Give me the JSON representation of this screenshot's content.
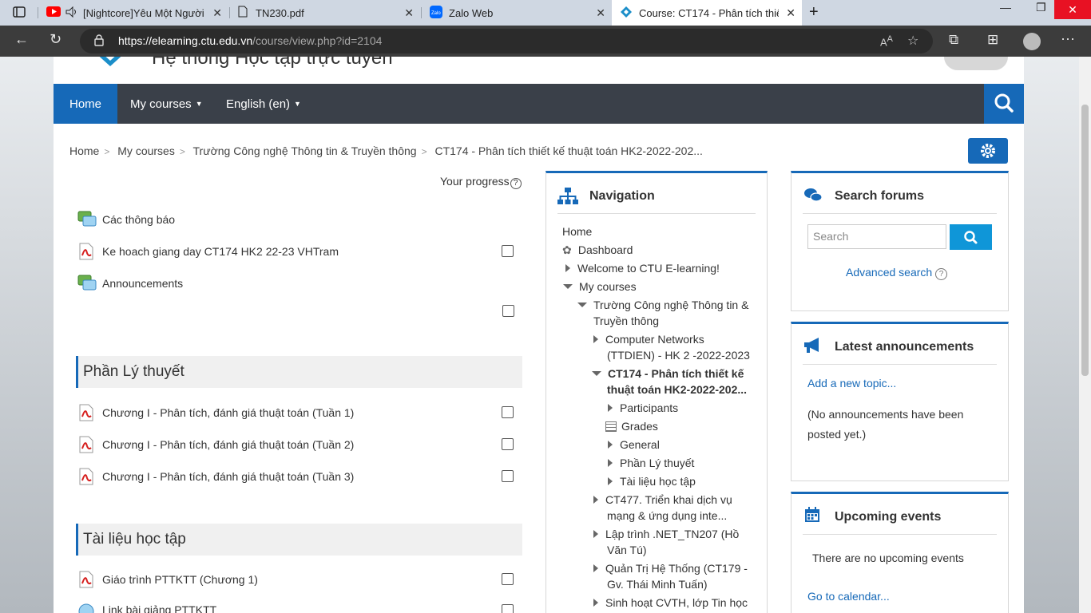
{
  "browser": {
    "tabs": [
      {
        "title": "[Nightcore]Yêu Một Người"
      },
      {
        "title": "TN230.pdf"
      },
      {
        "title": "Zalo Web"
      },
      {
        "title": "Course: CT174 - Phân tích thiết k"
      }
    ],
    "url_domain": "https://elearning.ctu.edu.vn",
    "url_path": "/course/view.php?id=2104"
  },
  "site": {
    "title": "Hệ thống Học tập trực tuyến"
  },
  "navbar": {
    "home": "Home",
    "my_courses": "My courses",
    "language": "English (en)"
  },
  "breadcrumb": [
    "Home",
    "My courses",
    "Trường Công nghệ Thông tin & Truyền thông",
    "CT174 - Phân tích thiết kế thuật toán HK2-2022-202..."
  ],
  "course": {
    "progress_label": "Your progress",
    "top_activities": [
      "Các thông báo",
      "Ke hoach giang day CT174 HK2 22-23 VHTram",
      "Announcements"
    ],
    "sections": [
      {
        "title": "Phần Lý thuyết",
        "activities": [
          "Chương I - Phân tích, đánh giá thuật toán (Tuần 1)",
          "Chương I - Phân tích, đánh giá thuật toán (Tuần 2)",
          "Chương I - Phân tích, đánh giá thuật toán (Tuần 3)"
        ]
      },
      {
        "title": "Tài liệu học tập",
        "activities": [
          "Giáo trình PTTKTT (Chương 1)",
          "Link bài giảng PTTKTT"
        ]
      }
    ]
  },
  "navigation": {
    "title": "Navigation",
    "home": "Home",
    "dashboard": "Dashboard",
    "welcome": "Welcome to CTU E-learning!",
    "my_courses": "My courses",
    "school_line1": "Trường Công nghệ Thông tin &",
    "school_line2": "Truyền thông",
    "cn_line1": "Computer Networks",
    "cn_line2": "(TTDIEN) - HK 2 -2022-2023",
    "ct174_line1": "CT174 - Phân tích thiết kế",
    "ct174_line2": "thuật toán HK2-2022-202...",
    "participants": "Participants",
    "grades": "Grades",
    "general": "General",
    "ly_thuyet": "Phần Lý thuyết",
    "tai_lieu": "Tài liệu học tập",
    "ct477_line1": "CT477. Triển khai dịch vụ",
    "ct477_line2": "mạng & ứng dụng inte...",
    "net_line1": "Lập trình .NET_TN207 (Hồ",
    "net_line2": "Văn Tú)",
    "qt_line1": "Quản Trị Hệ Thống (CT179 -",
    "qt_line2": "Gv. Thái Minh Tuấn)",
    "sh_line1": "Sinh hoạt CVTH, lớp Tin học"
  },
  "search_forums": {
    "title": "Search forums",
    "placeholder": "Search",
    "advanced": "Advanced search"
  },
  "latest_announcements": {
    "title": "Latest announcements",
    "add_topic": "Add a new topic...",
    "empty_line1": "(No announcements have been",
    "empty_line2": "posted yet.)"
  },
  "upcoming_events": {
    "title": "Upcoming events",
    "empty": "There are no upcoming events",
    "calendar": "Go to calendar..."
  },
  "colors": {
    "brand_blue": "#1669b8",
    "navbar_dark": "#3a4049",
    "search_button": "#0f96d8"
  }
}
